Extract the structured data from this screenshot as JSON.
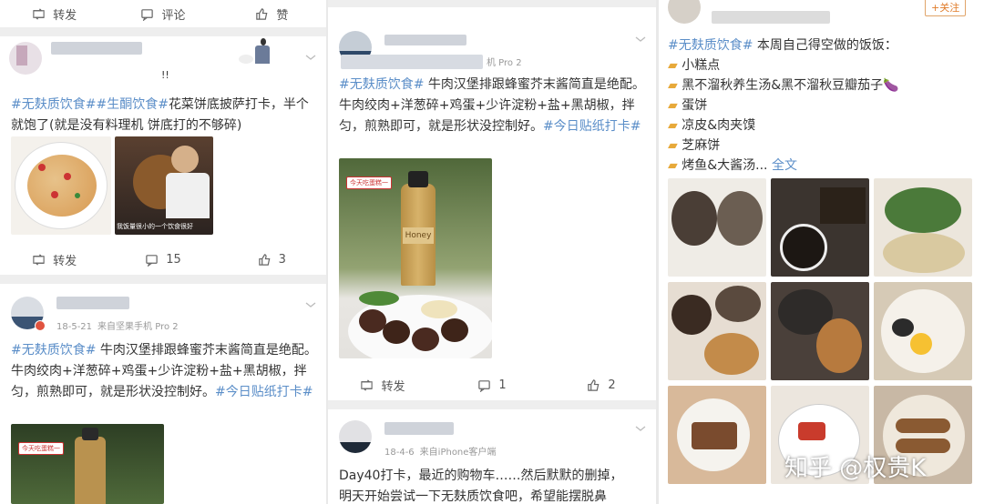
{
  "col1": {
    "top_actions": {
      "repost": "转发",
      "comment": "评论",
      "like": "赞"
    },
    "post1": {
      "name_suffix": "!!",
      "text_tag1": "#无麸质饮食#",
      "text_tag2": "#生酮饮食#",
      "text_body": "花菜饼底披萨打卡，半个就饱了(就是没有料理机 饼底打的不够碎)",
      "img2_caption": "我饭量很小的一个饮食很好",
      "actions": {
        "repost": "转发",
        "comment": "15",
        "like": "3"
      }
    },
    "post2": {
      "date": "18-5-21",
      "source": "来自坚果手机 Pro 2",
      "text_tag": "#无麸质饮食#",
      "text_body": " 牛肉汉堡排跟蜂蜜芥末酱简直是绝配。牛肉绞肉+洋葱碎+鸡蛋+少许淀粉+盐+黑胡椒，拌匀，煎熟即可，就是形状没控制好。",
      "text_tag2": "#今日贴纸打卡#",
      "sticker": "今天吃蛋糕一"
    }
  },
  "col2": {
    "post1": {
      "source": "机 Pro 2",
      "text_tag": "#无麸质饮食#",
      "text_body": " 牛肉汉堡排跟蜂蜜芥末酱简直是绝配。牛肉绞肉+洋葱碎+鸡蛋+少许淀粉+盐+黑胡椒，拌匀，煎熟即可，就是形状没控制好。",
      "text_tag2": "#今日贴纸打卡#",
      "sticker": "今天吃蛋糕一",
      "bottle_label": "Honey",
      "actions": {
        "repost": "转发",
        "comment": "1",
        "like": "2"
      }
    },
    "post2": {
      "date": "18-4-6",
      "source": "来自iPhone客户端",
      "line1": "Day40打卡，最近的购物车……然后默默的删掉，",
      "line2": "明天开始尝试一下无麸质饮食吧，希望能摆脱鼻"
    }
  },
  "col3": {
    "follow": "+关注",
    "header_tag": "#无麸质饮食#",
    "header_text": " 本周自己得空做的饭饭：",
    "items": [
      "小糕点",
      "黑不溜秋养生汤&黑不溜秋豆瓣茄子🍆",
      "蛋饼",
      "凉皮&肉夹馍",
      "芝麻饼",
      "烤鱼&大酱汤... "
    ],
    "expand": "全文",
    "watermark": "知乎 @权贵K"
  }
}
